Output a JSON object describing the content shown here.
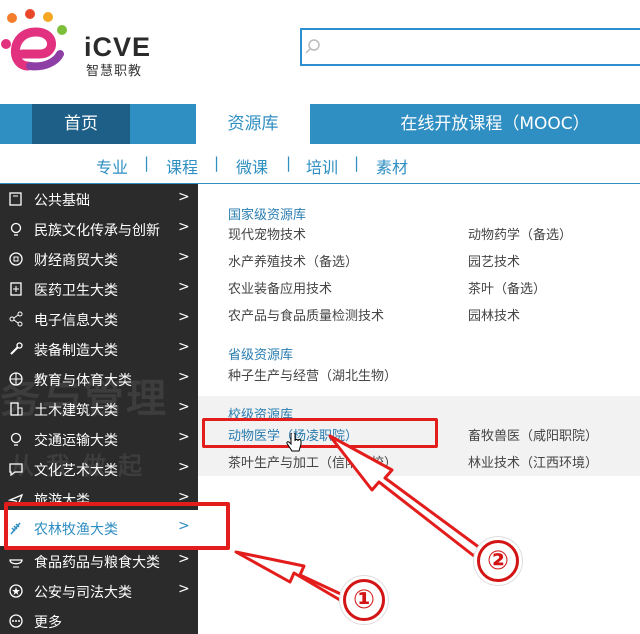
{
  "brand": {
    "name": "iCVE",
    "subtitle": "智慧职教"
  },
  "search": {
    "placeholder": ""
  },
  "nav": {
    "home": "首页",
    "resources": "资源库",
    "mooc": "在线开放课程（MOOC）"
  },
  "subtabs": [
    "专业",
    "课程",
    "微课",
    "培训",
    "素材"
  ],
  "subtab_separator": "|",
  "sidebar": {
    "items": [
      {
        "label": "公共基础",
        "icon": "book-icon"
      },
      {
        "label": "民族文化传承与创新",
        "icon": "lightbulb-icon"
      },
      {
        "label": "财经商贸大类",
        "icon": "coin-icon"
      },
      {
        "label": "医药卫生大类",
        "icon": "medical-icon"
      },
      {
        "label": "电子信息大类",
        "icon": "share-icon"
      },
      {
        "label": "装备制造大类",
        "icon": "wrench-icon"
      },
      {
        "label": "教育与体育大类",
        "icon": "ball-icon"
      },
      {
        "label": "土木建筑大类",
        "icon": "building-icon"
      },
      {
        "label": "交通运输大类",
        "icon": "lightbulb-icon"
      },
      {
        "label": "文化艺术大类",
        "icon": "chat-icon"
      },
      {
        "label": "旅游大类",
        "icon": "plane-icon"
      },
      {
        "label": "农林牧渔大类",
        "icon": "wheat-icon"
      },
      {
        "label": "食品药品与粮食大类",
        "icon": "bowl-icon"
      },
      {
        "label": "公安与司法大类",
        "icon": "star-badge-icon"
      },
      {
        "label": "更多",
        "icon": "more-icon"
      }
    ],
    "arrow": ">",
    "watermark_line1": "务与管理",
    "watermark_line2": "从我做起"
  },
  "content": {
    "national": {
      "title": "国家级资源库",
      "links": [
        "现代宠物技术",
        "动物药学（备选）",
        "水产养殖技术（备选）",
        "园艺技术",
        "农业装备应用技术",
        "茶叶（备选）",
        "农产品与食品质量检测技术",
        "园林技术"
      ]
    },
    "provincial": {
      "title": "省级资源库",
      "links": [
        "种子生产与经营（湖北生物）"
      ]
    },
    "school": {
      "title": "校级资源库",
      "links": [
        "动物医学（杨凌职院）",
        "畜牧兽医（咸阳职院）",
        "茶叶生产与加工（信阳茶校）",
        "林业技术（江西环境）"
      ]
    }
  },
  "annotations": {
    "step1": "①",
    "step2": "②",
    "color": "#e31c1c"
  },
  "colors": {
    "primary": "#2f8ec2",
    "nav_active": "#1e5f87",
    "sidebar_bg": "#2b2b2b"
  }
}
